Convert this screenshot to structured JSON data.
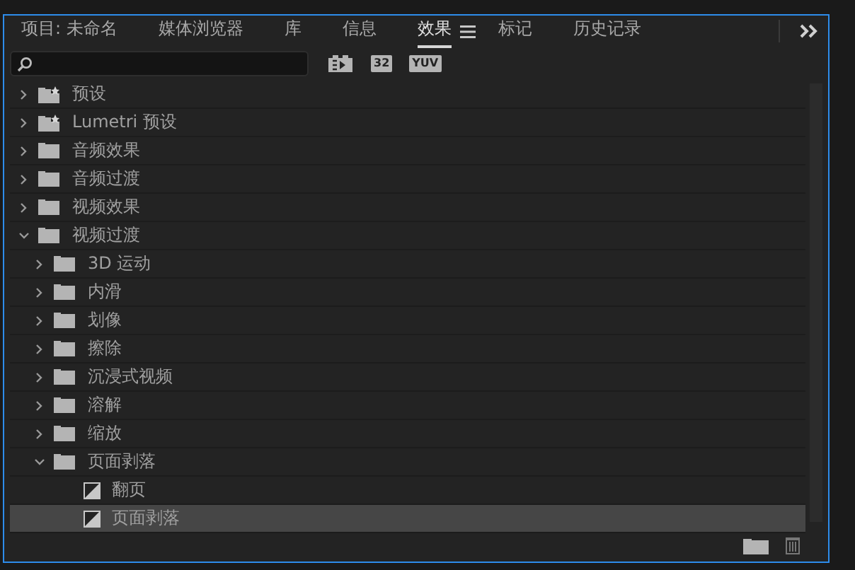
{
  "tabs": [
    {
      "label": "项目: 未命名",
      "selected": false
    },
    {
      "label": "媒体浏览器",
      "selected": false
    },
    {
      "label": "库",
      "selected": false
    },
    {
      "label": "信息",
      "selected": false
    },
    {
      "label": "效果",
      "selected": true
    },
    {
      "label": "标记",
      "selected": false
    },
    {
      "label": "历史记录",
      "selected": false
    }
  ],
  "filters": [
    {
      "kind": "accelerated"
    },
    {
      "kind": "badge",
      "label": "32"
    },
    {
      "kind": "badge",
      "label": "YUV"
    }
  ],
  "tree": [
    {
      "label": "预设",
      "kind": "preset",
      "expanded": false,
      "selected": false
    },
    {
      "label": "Lumetri 预设",
      "kind": "preset",
      "expanded": false,
      "selected": false
    },
    {
      "label": "音频效果",
      "kind": "folder",
      "expanded": false,
      "selected": false
    },
    {
      "label": "音频过渡",
      "kind": "folder",
      "expanded": false,
      "selected": false
    },
    {
      "label": "视频效果",
      "kind": "folder",
      "expanded": false,
      "selected": false
    },
    {
      "label": "视频过渡",
      "kind": "folder",
      "expanded": true,
      "selected": false,
      "children": [
        {
          "label": "3D 运动",
          "kind": "folder",
          "expanded": false,
          "selected": false
        },
        {
          "label": "内滑",
          "kind": "folder",
          "expanded": false,
          "selected": false
        },
        {
          "label": "划像",
          "kind": "folder",
          "expanded": false,
          "selected": false
        },
        {
          "label": "擦除",
          "kind": "folder",
          "expanded": false,
          "selected": false
        },
        {
          "label": "沉浸式视频",
          "kind": "folder",
          "expanded": false,
          "selected": false
        },
        {
          "label": "溶解",
          "kind": "folder",
          "expanded": false,
          "selected": false
        },
        {
          "label": "缩放",
          "kind": "folder",
          "expanded": false,
          "selected": false
        },
        {
          "label": "页面剥落",
          "kind": "folder",
          "expanded": true,
          "selected": false,
          "children": [
            {
              "label": "翻页",
              "kind": "effect",
              "selected": false
            },
            {
              "label": "页面剥落",
              "kind": "effect",
              "selected": true
            }
          ]
        }
      ]
    }
  ]
}
